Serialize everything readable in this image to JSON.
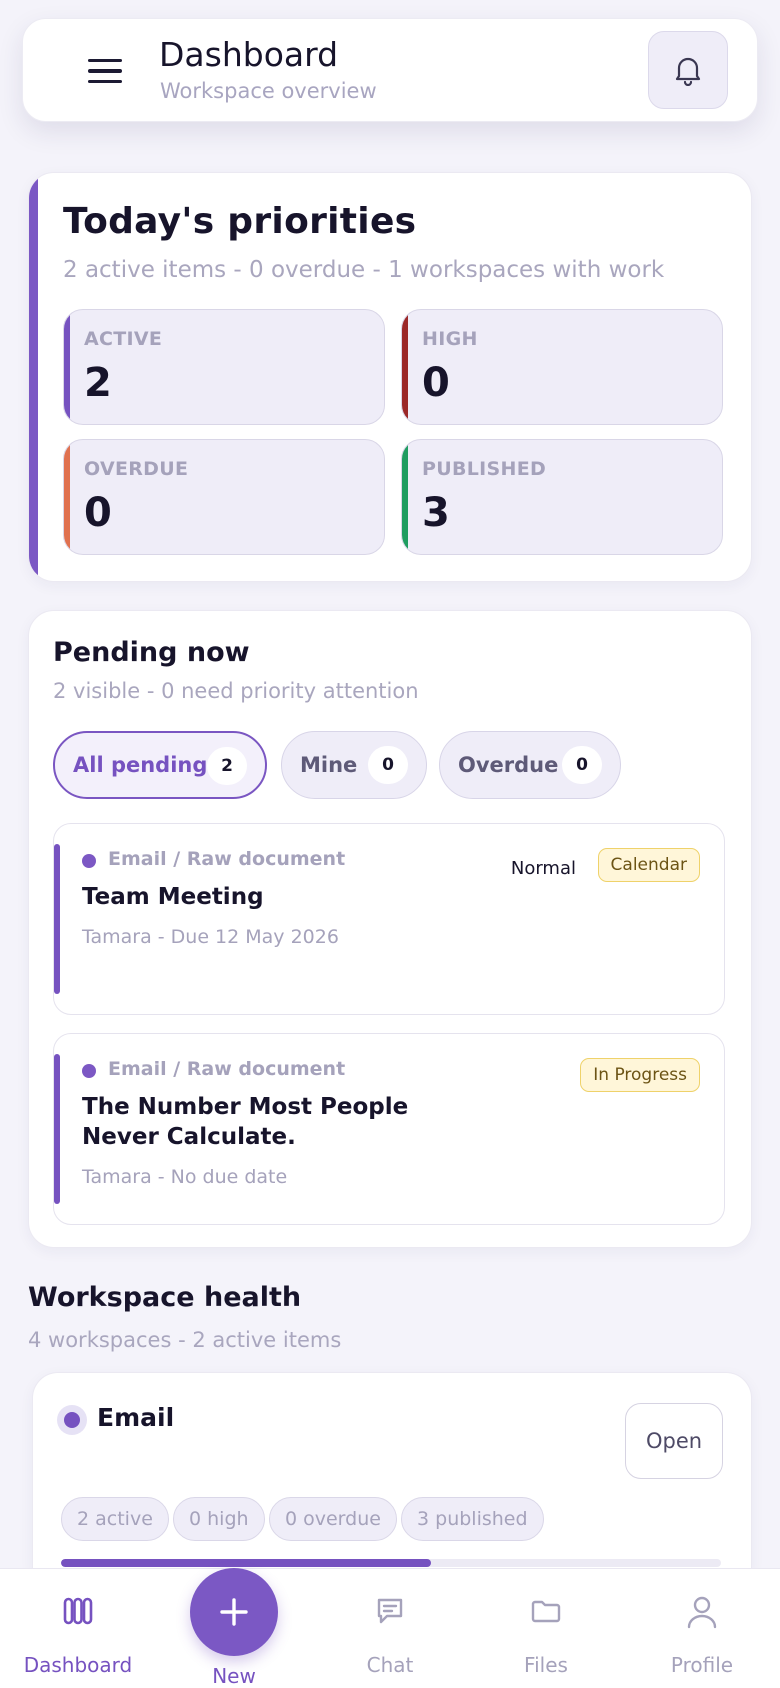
{
  "header": {
    "title": "Dashboard",
    "subtitle": "Workspace overview",
    "menu_icon": "hamburger-menu-icon",
    "bell_icon": "bell-icon"
  },
  "priorities": {
    "title": "Today's priorities",
    "subtitle": "2 active items - 0 overdue - 1 workspaces with work",
    "stats": [
      {
        "label": "ACTIVE",
        "value": "2",
        "color": "#7652c0"
      },
      {
        "label": "HIGH",
        "value": "0",
        "color": "#9b2828"
      },
      {
        "label": "OVERDUE",
        "value": "0",
        "color": "#e0714f"
      },
      {
        "label": "PUBLISHED",
        "value": "3",
        "color": "#1f9d60"
      }
    ]
  },
  "pending": {
    "title": "Pending now",
    "subtitle": "2 visible - 0 need priority attention",
    "filters": [
      {
        "label": "All pending",
        "count": "2",
        "active": true
      },
      {
        "label": "Mine",
        "count": "0",
        "active": false
      },
      {
        "label": "Overdue",
        "count": "0",
        "active": false
      }
    ],
    "items": [
      {
        "source": "Email / Raw document",
        "title": "Team Meeting",
        "meta": "Tamara - Due 12 May 2026",
        "priority": "Normal",
        "badge": "Calendar"
      },
      {
        "source": "Email / Raw document",
        "title": "The Number Most People Never Calculate.",
        "meta": "Tamara - No due date",
        "priority": "",
        "badge": "In Progress"
      }
    ]
  },
  "workspace_health": {
    "title": "Workspace health",
    "subtitle": "4 workspaces - 2 active items",
    "workspaces": [
      {
        "name": "Email",
        "open_label": "Open",
        "pills": [
          "2 active",
          "0 high",
          "0 overdue",
          "3 published"
        ],
        "progress": 0.56
      }
    ]
  },
  "nav": {
    "items": [
      {
        "label": "Dashboard",
        "icon": "dashboard-icon",
        "active": true
      },
      {
        "label": "New",
        "icon": "plus-icon",
        "active": false
      },
      {
        "label": "Chat",
        "icon": "chat-icon",
        "active": false
      },
      {
        "label": "Files",
        "icon": "folder-icon",
        "active": false
      },
      {
        "label": "Profile",
        "icon": "profile-icon",
        "active": false
      }
    ]
  },
  "colors": {
    "accent": "#7652c0",
    "background": "#f4f3fa"
  }
}
